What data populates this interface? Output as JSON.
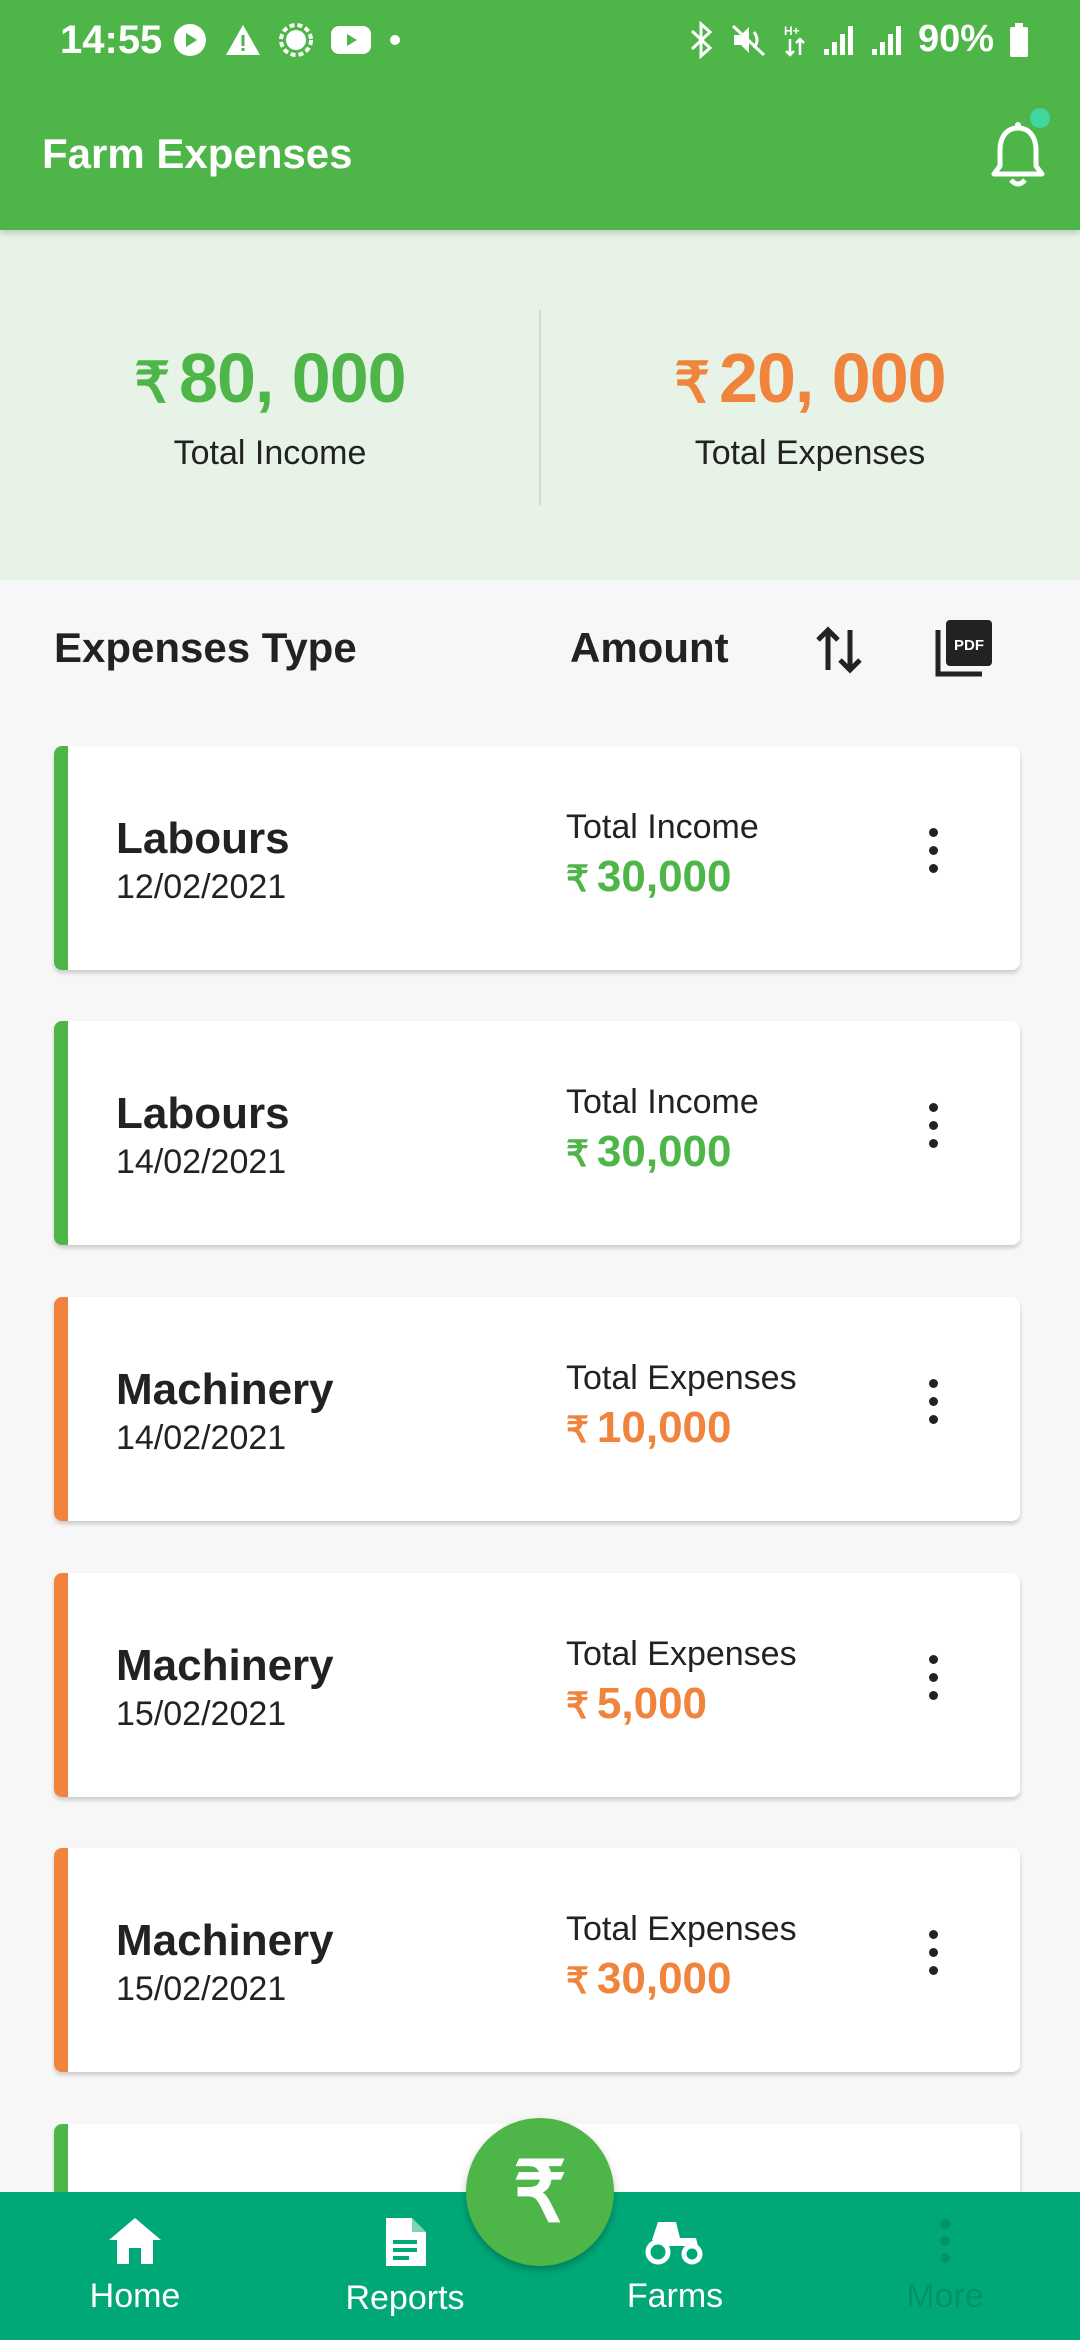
{
  "status_bar": {
    "time": "14:55",
    "battery": "90%"
  },
  "app_bar": {
    "title": "Farm Expenses"
  },
  "summary": {
    "currency": "₹",
    "income_amount": "80, 000",
    "income_label": "Total Income",
    "expenses_amount": "20, 000",
    "expenses_label": "Total Expenses"
  },
  "list_header": {
    "type_label": "Expenses Type",
    "amount_label": "Amount"
  },
  "entries": [
    {
      "name": "Labours",
      "date": "12/02/2021",
      "type": "Total Income",
      "amount": "30,000",
      "kind": "income"
    },
    {
      "name": "Labours",
      "date": "14/02/2021",
      "type": "Total Income",
      "amount": "30,000",
      "kind": "income"
    },
    {
      "name": "Machinery",
      "date": "14/02/2021",
      "type": "Total Expenses",
      "amount": "10,000",
      "kind": "expense"
    },
    {
      "name": "Machinery",
      "date": "15/02/2021",
      "type": "Total Expenses",
      "amount": "5,000",
      "kind": "expense"
    },
    {
      "name": "Machinery",
      "date": "15/02/2021",
      "type": "Total Expenses",
      "amount": "30,000",
      "kind": "expense"
    },
    {
      "name": "",
      "date": "",
      "type": "",
      "amount": "",
      "kind": "income"
    }
  ],
  "bottom_nav": {
    "home": "Home",
    "reports": "Reports",
    "farms": "Farms",
    "more": "More"
  },
  "fab": {
    "symbol": "₹"
  },
  "colors": {
    "primary_green": "#4eb548",
    "expense_orange": "#f0843c",
    "nav_teal": "#00a878",
    "summary_bg": "#e7f3e6"
  }
}
